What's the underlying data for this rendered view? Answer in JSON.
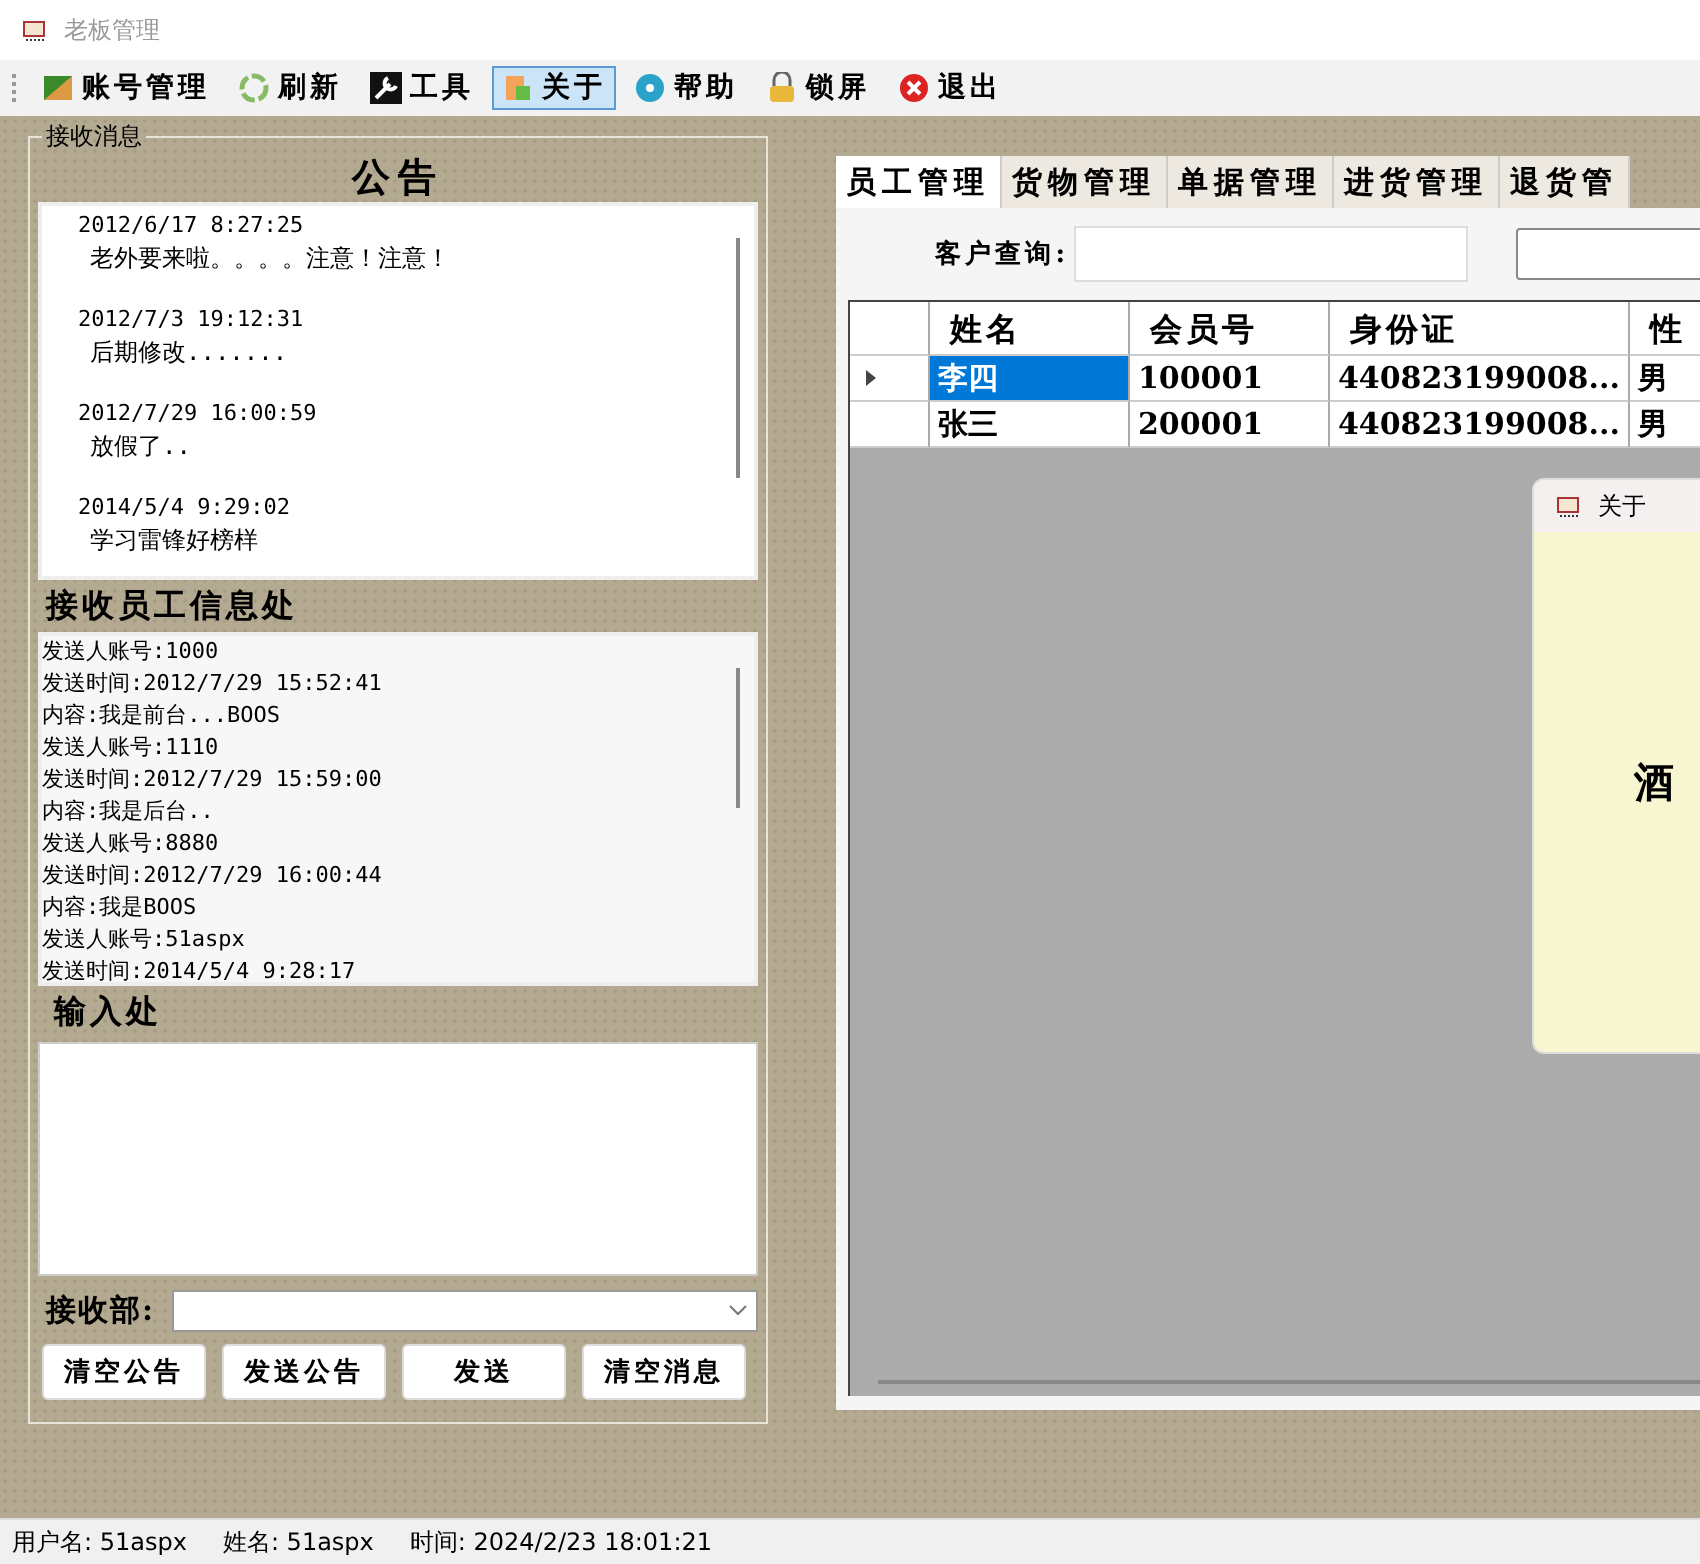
{
  "window": {
    "title": "老板管理"
  },
  "toolbar": [
    {
      "label": "账号管理",
      "selected": false
    },
    {
      "label": "刷新",
      "selected": false
    },
    {
      "label": "工具",
      "selected": false
    },
    {
      "label": "关于",
      "selected": true
    },
    {
      "label": "帮助",
      "selected": false
    },
    {
      "label": "锁屏",
      "selected": false
    },
    {
      "label": "退出",
      "selected": false
    }
  ],
  "receive_group": {
    "legend": "接收消息",
    "notice_title": "公告",
    "notices": [
      {
        "time": "2012/6/17 8:27:25",
        "text": "老外要来啦。。。。注意！注意！"
      },
      {
        "time": "2012/7/3 19:12:31",
        "text": "后期修改......."
      },
      {
        "time": "2012/7/29 16:00:59",
        "text": "放假了.."
      },
      {
        "time": "2014/5/4 9:29:02",
        "text": "学习雷锋好榜样"
      }
    ],
    "messages_title": "接收员工信息处",
    "messages": [
      "发送人账号:1000",
      "发送时间:2012/7/29 15:52:41",
      "内容:我是前台...BOOS",
      "发送人账号:1110",
      "发送时间:2012/7/29 15:59:00",
      "内容:我是后台..",
      "发送人账号:8880",
      "发送时间:2012/7/29 16:00:44",
      "内容:我是BOOS",
      "发送人账号:51aspx",
      "发送时间:2014/5/4 9:28:17"
    ],
    "input_title": "输入处",
    "receiver_label": "接收部:",
    "buttons": [
      "清空公告",
      "发送公告",
      "发送",
      "清空消息"
    ]
  },
  "tabs": [
    {
      "label": "员工管理",
      "selected": true
    },
    {
      "label": "货物管理",
      "selected": false
    },
    {
      "label": "单据管理",
      "selected": false
    },
    {
      "label": "进货管理",
      "selected": false
    },
    {
      "label": "退货管",
      "selected": false
    }
  ],
  "search": {
    "label": "客户查询:"
  },
  "table": {
    "columns": [
      "姓名",
      "会员号",
      "身份证",
      "性"
    ],
    "rows": [
      {
        "selected": true,
        "cells": [
          "李四",
          "100001",
          "440823199008...",
          "男"
        ]
      },
      {
        "selected": false,
        "cells": [
          "张三",
          "200001",
          "440823199008...",
          "男"
        ]
      }
    ]
  },
  "about_dialog": {
    "title": "关于",
    "text": "酒"
  },
  "status_bar": [
    "用户名: 51aspx",
    "姓名: 51aspx",
    "时间: 2024/2/23 18:01:21"
  ]
}
